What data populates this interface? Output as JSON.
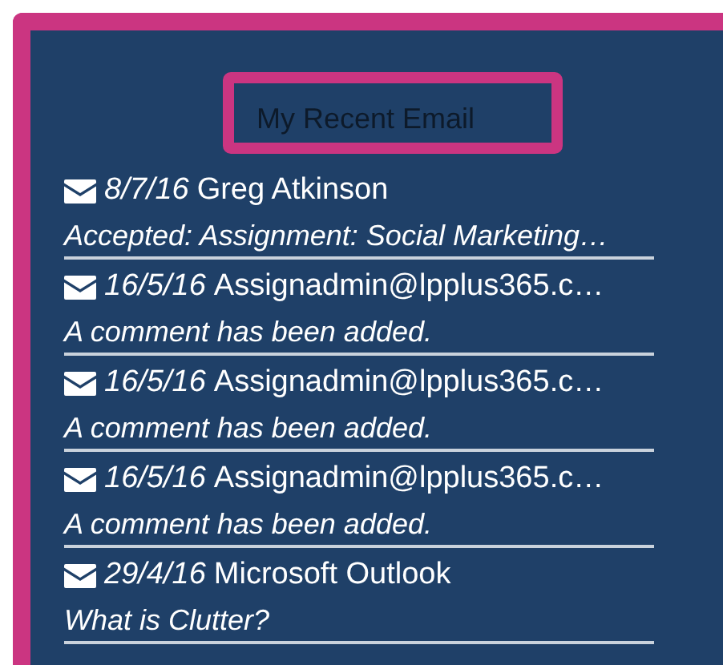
{
  "title": "My Recent Email",
  "emails": [
    {
      "date": "8/7/16",
      "sender": "Greg Atkinson",
      "subject": "Accepted: Assignment: Social Marketing…"
    },
    {
      "date": "16/5/16",
      "sender": "Assignadmin@lpplus365.c…",
      "subject": "A comment has been added."
    },
    {
      "date": "16/5/16",
      "sender": "Assignadmin@lpplus365.c…",
      "subject": "A comment has been added."
    },
    {
      "date": "16/5/16",
      "sender": "Assignadmin@lpplus365.c…",
      "subject": "A comment has been added."
    },
    {
      "date": "29/4/16",
      "sender": "Microsoft Outlook",
      "subject": "What is Clutter?"
    }
  ]
}
